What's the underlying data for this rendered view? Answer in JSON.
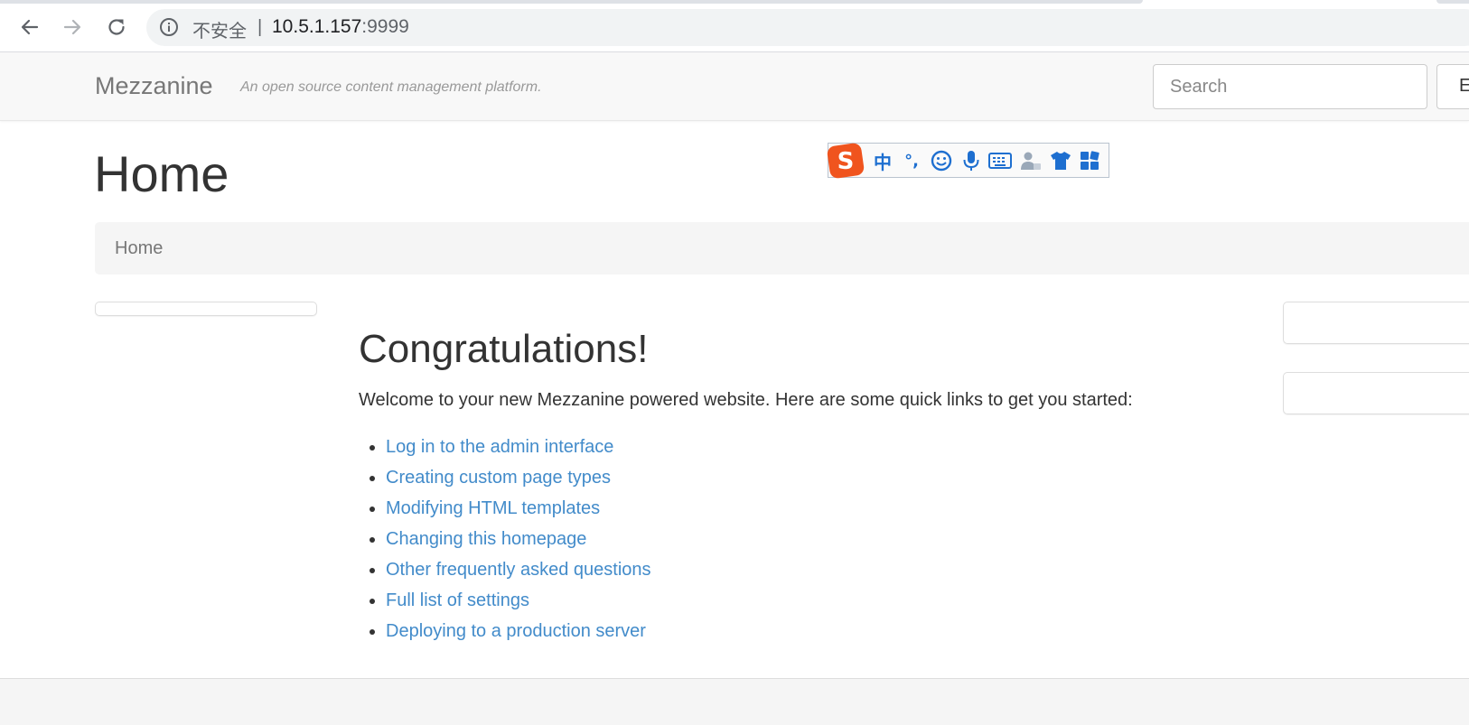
{
  "browser": {
    "insecure_label": "不安全",
    "separator": "|",
    "url_host": "10.5.1.157",
    "url_port": ":9999"
  },
  "navbar": {
    "brand": "Mezzanine",
    "tagline": "An open source content management platform.",
    "search_placeholder": "Search",
    "search_button_label": "E"
  },
  "page": {
    "title": "Home",
    "breadcrumb": [
      "Home"
    ],
    "heading": "Congratulations!",
    "intro": "Welcome to your new Mezzanine powered website. Here are some quick links to get you started:",
    "links": [
      "Log in to the admin interface",
      "Creating custom page types",
      "Modifying HTML templates",
      "Changing this homepage",
      "Other frequently asked questions",
      "Full list of settings",
      "Deploying to a production server"
    ]
  },
  "ime_toolbar": {
    "logo_letter": "S",
    "mode_label": "中",
    "punct_label": "°,",
    "icons": [
      "emoji-icon",
      "microphone-icon",
      "keyboard-icon",
      "user-icon",
      "skin-shirt-icon",
      "toolbox-grid-icon"
    ]
  },
  "colors": {
    "link": "#428bca",
    "navbar_bg": "#f8f8f8",
    "ime_blue": "#1e6fd0",
    "ime_logo": "#f0541e"
  }
}
